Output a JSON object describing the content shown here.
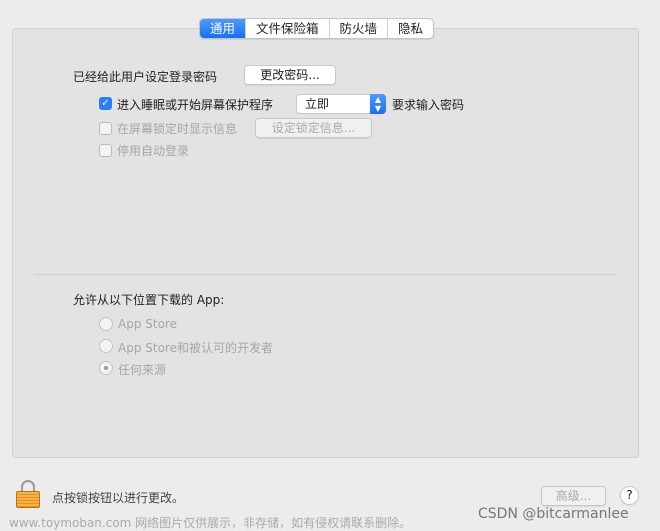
{
  "tabs": [
    {
      "label": "通用",
      "active": true
    },
    {
      "label": "文件保险箱"
    },
    {
      "label": "防火墙"
    },
    {
      "label": "隐私"
    }
  ],
  "general": {
    "password_set_label": "已经给此用户设定登录密码",
    "change_password_button": "更改密码...",
    "require_password": {
      "checked": true,
      "label": "进入睡眠或开始屏幕保护程序",
      "select_value": "立即",
      "suffix": "要求输入密码"
    },
    "show_message": {
      "checked": false,
      "disabled": true,
      "label": "在屏幕锁定时显示信息",
      "button": "设定锁定信息..."
    },
    "disable_auto_login": {
      "checked": false,
      "disabled": true,
      "label": "停用自动登录"
    }
  },
  "downloads": {
    "title": "允许从以下位置下载的 App:",
    "options": [
      {
        "label": "App Store",
        "selected": false
      },
      {
        "label": "App Store和被认可的开发者",
        "selected": false
      },
      {
        "label": "任何来源",
        "selected": true
      }
    ]
  },
  "footer": {
    "lock_text": "点按锁按钮以进行更改。",
    "advanced_button": "高级...",
    "help_button": "?"
  },
  "watermark": {
    "left": "www.toymoban.com 网络图片仅供展示，非存储，如有侵权请联系删除。",
    "right": "CSDN @bitcarmanlee"
  },
  "colors": {
    "accent": "#2a7ff5",
    "lock": "#f0a020"
  }
}
